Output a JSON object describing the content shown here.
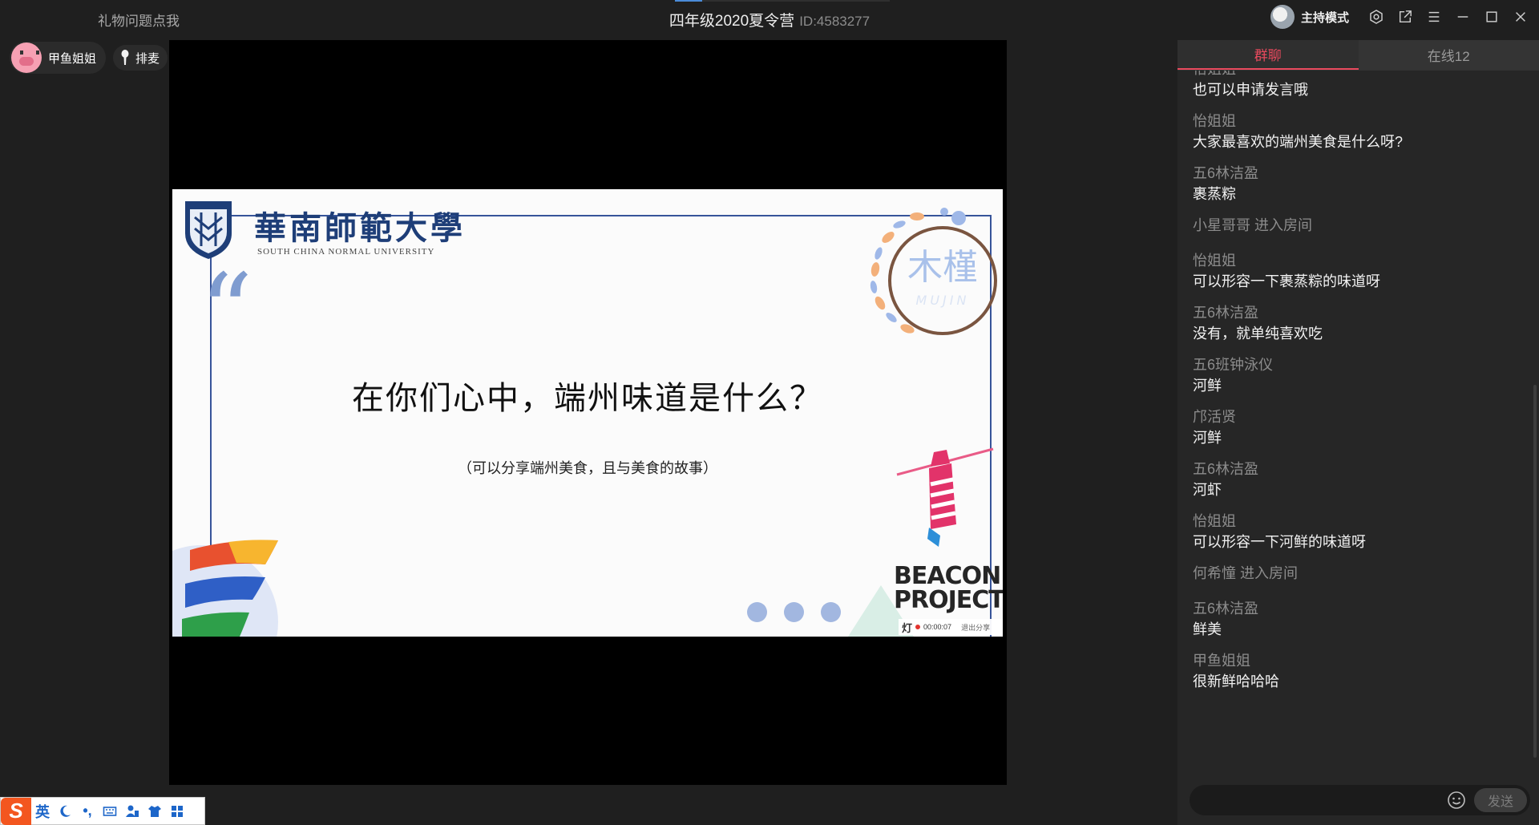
{
  "topbar": {
    "gift_link": "礼物问题点我",
    "room_title": "四年级2020夏令营",
    "room_id": "ID:4583277",
    "host_mode": "主持模式",
    "icons": [
      "settings-icon",
      "share-icon",
      "menu-icon",
      "minimize-icon",
      "maximize-icon",
      "close-icon"
    ]
  },
  "stage": {
    "user_name": "甲鱼姐姐",
    "queue_label": "排麦"
  },
  "slide": {
    "university_name": "華南師範大學",
    "university_en": "SOUTH CHINA NORMAL UNIVERSITY",
    "quote_mark": "“",
    "seal_text": "木槿",
    "seal_sub": "MUJIN",
    "question": "在你们心中，端州味道是什么？",
    "sub_question": "（可以分享端州美食，且与美食的故事）",
    "beacon_line1": "BEACON",
    "beacon_line2": "PROJECT",
    "recording": {
      "lamp": "灯",
      "time": "00:00:07",
      "stop_label": "退出分享"
    }
  },
  "chat": {
    "tabs": [
      {
        "label": "群聊",
        "active": true
      },
      {
        "label": "在线12",
        "active": false
      }
    ],
    "clipped_sender": "怡姐姐",
    "messages": [
      {
        "sender": "",
        "text": "也可以申请发言哦"
      },
      {
        "sender": "怡姐姐",
        "text": "大家最喜欢的端州美食是什么呀?"
      },
      {
        "sender": "五6林洁盈",
        "text": "裹蒸粽"
      },
      {
        "system": "小星哥哥 进入房间"
      },
      {
        "sender": "怡姐姐",
        "text": "可以形容一下裹蒸粽的味道呀"
      },
      {
        "sender": "五6林洁盈",
        "text": "没有，就单纯喜欢吃"
      },
      {
        "sender": "五6班钟泳仪",
        "text": "河鲜"
      },
      {
        "sender": "邝活贤",
        "text": "河鲜"
      },
      {
        "sender": "五6林洁盈",
        "text": "河虾"
      },
      {
        "sender": "怡姐姐",
        "text": "可以形容一下河鲜的味道呀"
      },
      {
        "system": "何希憧 进入房间"
      },
      {
        "sender": "五6林洁盈",
        "text": "鲜美"
      },
      {
        "sender": "甲鱼姐姐",
        "text": "很新鲜哈哈哈"
      }
    ],
    "input_placeholder": "",
    "send_label": "发送"
  },
  "ime": {
    "logo": "S",
    "mode": "英",
    "punct": "•,"
  },
  "colors": {
    "accent": "#ea4a5e",
    "background": "#1f1f1f",
    "panel": "#262626",
    "slide_frame": "#37549a"
  }
}
